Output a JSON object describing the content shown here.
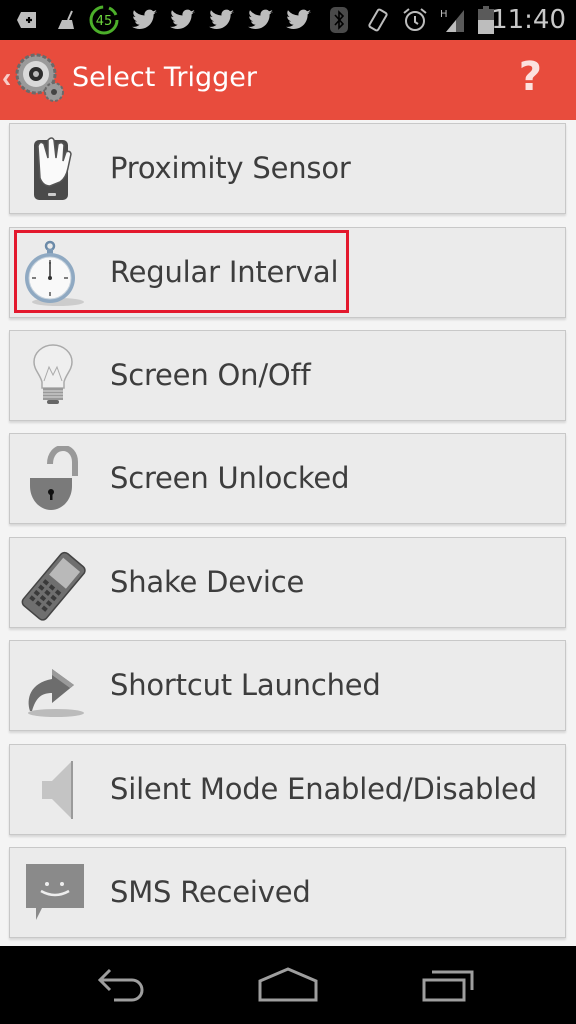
{
  "status_bar": {
    "icons": [
      "add-notification-icon",
      "cleaner-broom-icon",
      "battery-percent-badge-icon",
      "twitter-icon",
      "twitter-icon",
      "twitter-icon",
      "twitter-icon",
      "twitter-icon",
      "bluetooth-icon",
      "rotate-icon",
      "alarm-icon",
      "signal-h-icon",
      "battery-icon"
    ],
    "badge_number": "45",
    "network_type": "H",
    "time": "11:40"
  },
  "action_bar": {
    "back_glyph": "‹",
    "title": "Select Trigger",
    "help_glyph": "?",
    "background_color": "#e84c3d"
  },
  "triggers": [
    {
      "label": "Proximity Sensor",
      "icon": "proximity-hand-phone-icon"
    },
    {
      "label": "Regular Interval",
      "icon": "stopwatch-icon"
    },
    {
      "label": "Screen On/Off",
      "icon": "light-bulb-icon"
    },
    {
      "label": "Screen Unlocked",
      "icon": "unlocked-padlock-icon"
    },
    {
      "label": "Shake Device",
      "icon": "mobile-phone-icon"
    },
    {
      "label": "Shortcut Launched",
      "icon": "shortcut-arrow-icon"
    },
    {
      "label": "Silent Mode Enabled/Disabled",
      "icon": "speaker-icon"
    },
    {
      "label": "SMS Received",
      "icon": "sms-bubble-icon"
    }
  ],
  "highlighted_item": "Regular Interval",
  "highlight_color": "#e3182d",
  "nav_bar": {
    "buttons": [
      "back",
      "home",
      "recents"
    ]
  }
}
